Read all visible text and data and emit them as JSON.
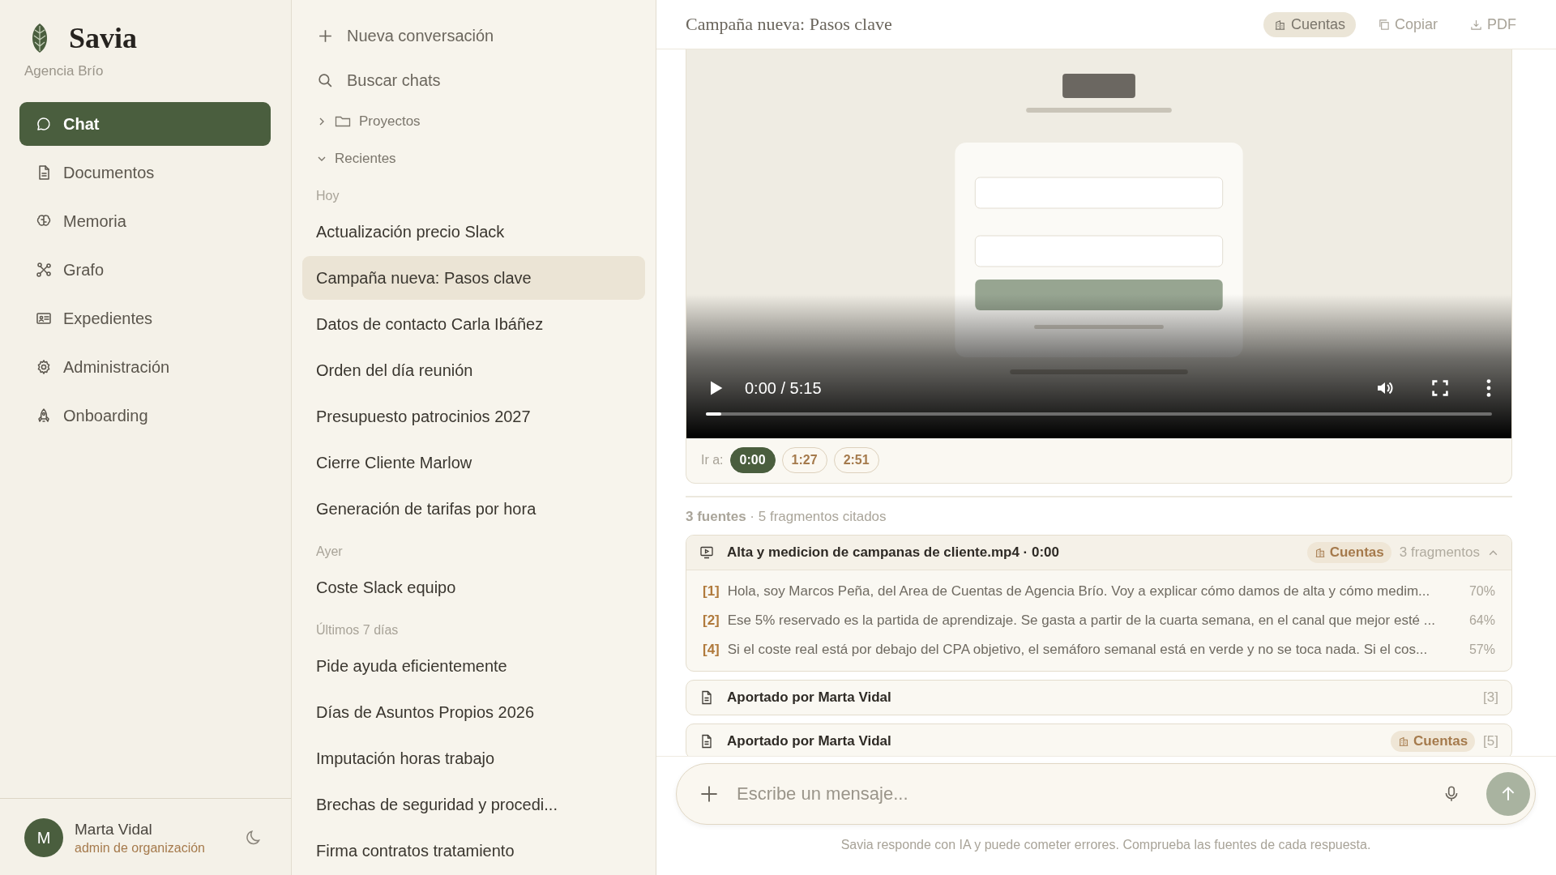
{
  "brand": {
    "name": "Savia",
    "org": "Agencia Brío"
  },
  "nav": [
    {
      "label": "Chat",
      "selected": true
    },
    {
      "label": "Documentos",
      "selected": false
    },
    {
      "label": "Memoria",
      "selected": false
    },
    {
      "label": "Grafo",
      "selected": false
    },
    {
      "label": "Expedientes",
      "selected": false
    },
    {
      "label": "Administración",
      "selected": false
    },
    {
      "label": "Onboarding",
      "selected": false
    }
  ],
  "user": {
    "initial": "M",
    "name": "Marta Vidal",
    "role": "admin de organización"
  },
  "chat_panel": {
    "new_chat": "Nueva conversación",
    "search": "Buscar chats",
    "folders": [
      {
        "label": "Proyectos",
        "expanded": false
      },
      {
        "label": "Recientes",
        "expanded": true
      }
    ],
    "groups": [
      {
        "heading": "Hoy",
        "chats": [
          {
            "title": "Actualización precio Slack",
            "selected": false
          },
          {
            "title": "Campaña nueva: Pasos clave",
            "selected": true
          },
          {
            "title": "Datos de contacto Carla Ibáñez",
            "selected": false
          },
          {
            "title": "Orden del día reunión",
            "selected": false
          },
          {
            "title": "Presupuesto patrocinios 2027",
            "selected": false
          },
          {
            "title": "Cierre Cliente Marlow",
            "selected": false
          },
          {
            "title": "Generación de tarifas por hora",
            "selected": false
          }
        ]
      },
      {
        "heading": "Ayer",
        "chats": [
          {
            "title": "Coste Slack equipo",
            "selected": false
          }
        ]
      },
      {
        "heading": "Últimos 7 días",
        "chats": [
          {
            "title": "Pide ayuda eficientemente",
            "selected": false
          },
          {
            "title": "Días de Asuntos Propios 2026",
            "selected": false
          },
          {
            "title": "Imputación horas trabajo",
            "selected": false
          },
          {
            "title": "Brechas de seguridad y procedi...",
            "selected": false
          },
          {
            "title": "Firma contratos tratamiento",
            "selected": false
          }
        ]
      }
    ]
  },
  "conversation": {
    "title": "Campaña nueva: Pasos clave",
    "actions": [
      {
        "label": "Cuentas",
        "kind": "tag"
      },
      {
        "label": "Copiar",
        "kind": "button"
      },
      {
        "label": "PDF",
        "kind": "button"
      }
    ]
  },
  "video": {
    "kind": "picture",
    "time": "0:00 / 5:15",
    "level": 0.02,
    "jump_label": "Ir a:",
    "chapters": [
      {
        "label": "0:00",
        "selected": true
      },
      {
        "label": "1:27",
        "selected": false
      },
      {
        "label": "2:51",
        "selected": false
      }
    ]
  },
  "sources": {
    "summary": "**3 fuentes** · 5 fragmentos citados",
    "items": [
      {
        "kind": "video",
        "title": "Alta y medicion de campanas de cliente.mp4 · 0:00",
        "tag": "Cuentas",
        "count": "3 fragmentos",
        "expanded": true,
        "fragments": [
          {
            "ref": "[1]",
            "text": "Hola, soy Marcos Peña, del Area de Cuentas de Agencia Brío. Voy a explicar cómo damos de alta y cómo medim...",
            "score": "70%"
          },
          {
            "ref": "[2]",
            "text": "Ese 5% reservado es la partida de aprendizaje. Se gasta a partir de la cuarta semana, en el canal que mejor esté ...",
            "score": "64%"
          },
          {
            "ref": "[4]",
            "text": "Si el coste real está por debajo del CPA objetivo, el semáforo semanal está en verde y no se toca nada. Si el cos...",
            "score": "57%"
          }
        ]
      },
      {
        "kind": "document",
        "title": "Aportado por Marta Vidal",
        "ref": "[3]"
      },
      {
        "kind": "document",
        "title": "Aportado por Marta Vidal",
        "tag": "Cuentas",
        "ref": "[5]"
      }
    ]
  },
  "composer": {
    "placeholder": "Escribe un mensaje...",
    "disclaimer": "Savia responde con IA y puede cometer errores. Comprueba las fuentes de cada respuesta."
  }
}
